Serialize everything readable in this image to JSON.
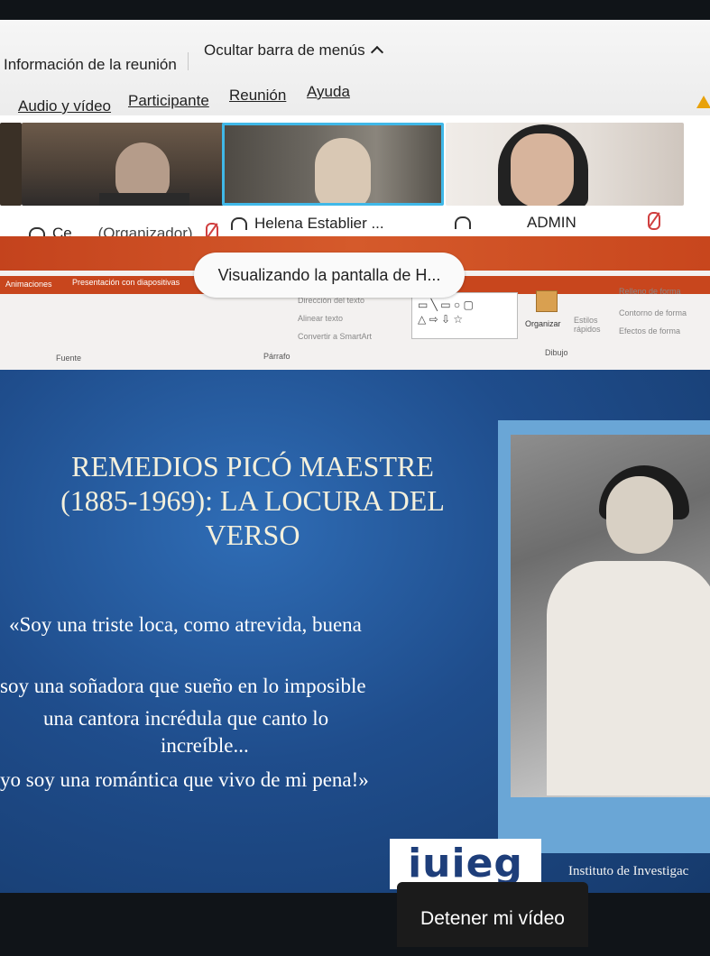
{
  "meeting_bar": {
    "meeting_info": "Información de la reunión",
    "hide_menu": "Ocultar barra de menús",
    "menus": [
      "Audio y vídeo",
      "Participante",
      "Reunión",
      "Ayuda"
    ]
  },
  "participants": [
    {
      "name": "Ce...",
      "role": "(Organizador)"
    },
    {
      "name": "Helena Establier ..."
    },
    {
      "name": "ADMIN"
    }
  ],
  "ppt": {
    "tabs": [
      "Animaciones",
      "Presentación con diapositivas"
    ],
    "groups": [
      "Fuente",
      "Párrafo",
      "Dibujo"
    ],
    "commands": {
      "text_direction": "Dirección del texto",
      "align_text": "Alinear texto",
      "smartart": "Convertir a SmartArt",
      "arrange": "Organizar",
      "quick_styles": "Estilos rápidos",
      "shape_fill": "Relleno de forma",
      "shape_outline": "Contorno de forma",
      "shape_effects": "Efectos de forma"
    }
  },
  "sharing_banner": "Visualizando la pantalla de H...",
  "slide": {
    "title": "REMEDIOS PICÓ MAESTRE (1885-1969): LA LOCURA DEL VERSO",
    "quote_lines": [
      "«Soy una triste loca, como atrevida, buena",
      "soy una soñadora que sueño en lo imposible",
      "una cantora incrédula que canto lo",
      "increíble...",
      "yo soy una romántica que vivo de mi pena!»"
    ],
    "logo": "iuieg",
    "institute": "Instituto de Investigac"
  },
  "tooltip": "Detener mi vídeo",
  "colors": {
    "ribbon_orange": "#c8461d",
    "slide_blue": "#1f4d8c",
    "title_cream": "#f4f0dc"
  }
}
